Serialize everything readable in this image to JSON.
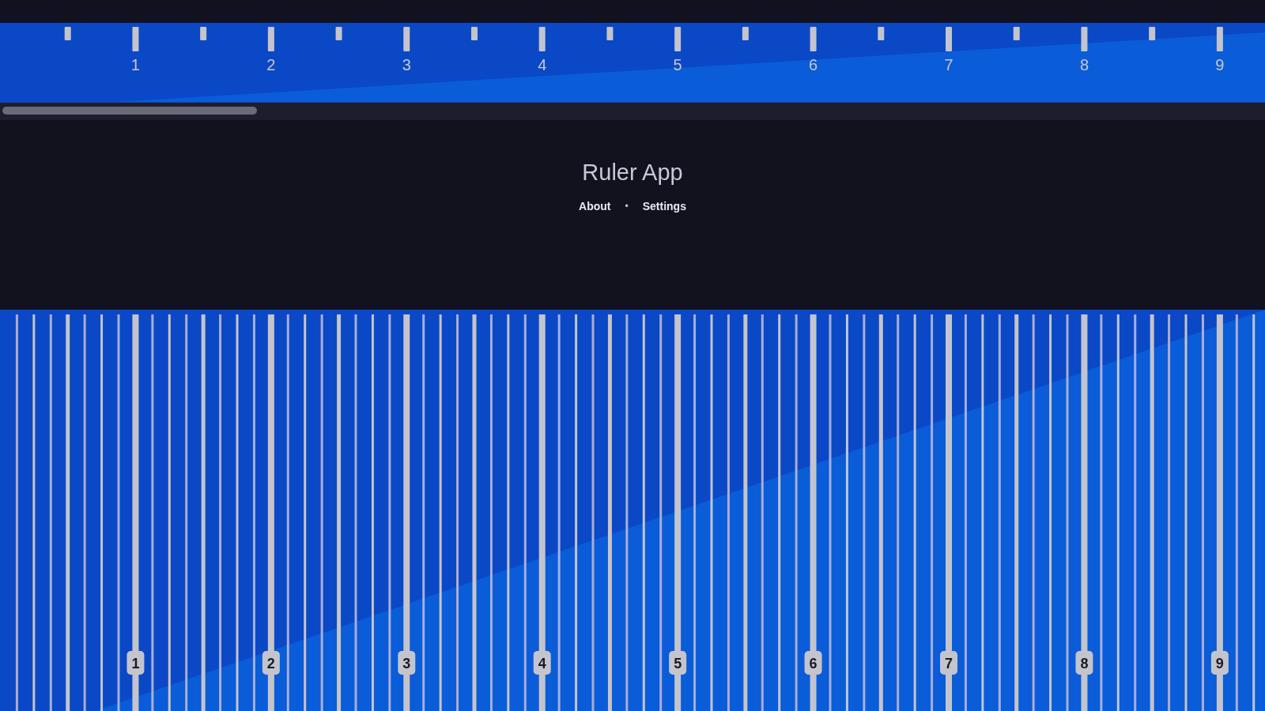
{
  "top_ruler": {
    "labels": [
      "1",
      "2",
      "3",
      "4",
      "5",
      "6",
      "7",
      "8",
      "9"
    ]
  },
  "header": {
    "title": "Ruler App",
    "links": [
      {
        "label": "About"
      },
      {
        "label": "Settings"
      }
    ],
    "separator": "•"
  },
  "bottom_ruler": {
    "labels": [
      "1",
      "2",
      "3",
      "4",
      "5",
      "6",
      "7",
      "8",
      "9"
    ]
  }
}
